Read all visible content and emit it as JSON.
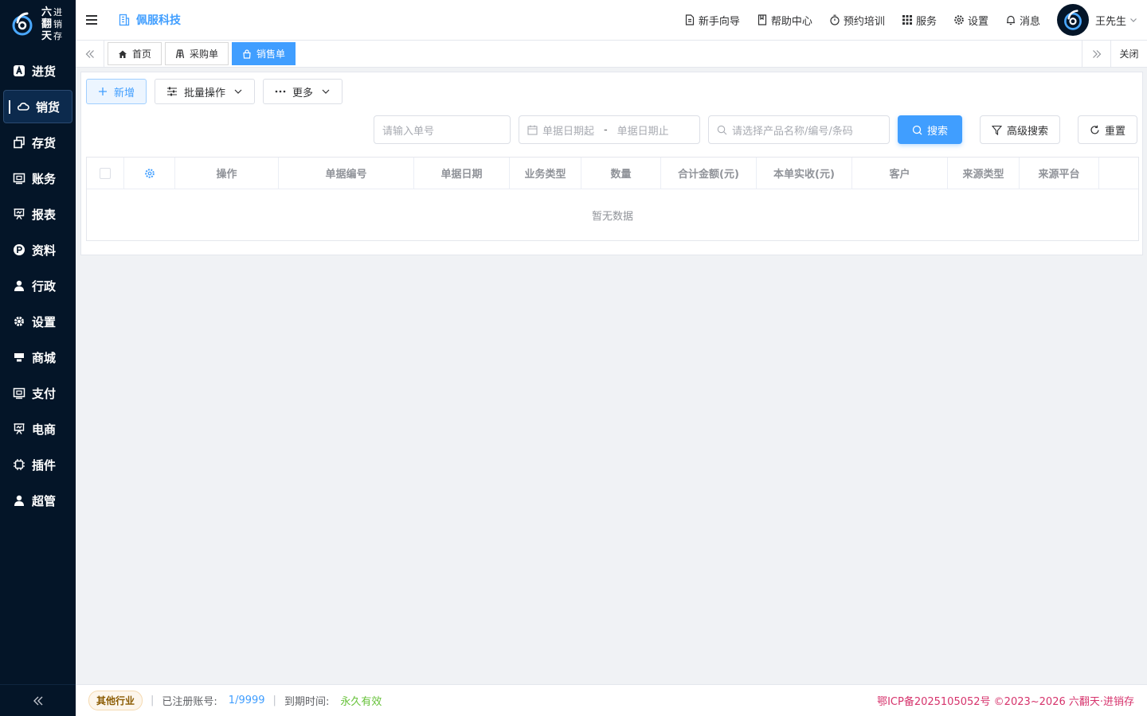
{
  "brand": {
    "name_big": [
      "六",
      "翻",
      "天"
    ],
    "name_small": [
      "进",
      "销",
      "存"
    ],
    "logo_icon": "six-spiral-logo"
  },
  "sidebar": {
    "items": [
      {
        "label": "进货",
        "icon": "a-box-icon",
        "active": false
      },
      {
        "label": "销货",
        "icon": "cloud-icon",
        "active": true
      },
      {
        "label": "存货",
        "icon": "copy-icon",
        "active": false
      },
      {
        "label": "账务",
        "icon": "wallet-icon",
        "active": false
      },
      {
        "label": "报表",
        "icon": "presentation-icon",
        "active": false
      },
      {
        "label": "资料",
        "icon": "p-circle-icon",
        "active": false
      },
      {
        "label": "行政",
        "icon": "user-icon",
        "active": false
      },
      {
        "label": "设置",
        "icon": "gear-icon",
        "active": false
      },
      {
        "label": "商城",
        "icon": "store-icon",
        "active": false
      },
      {
        "label": "支付",
        "icon": "wallet-icon",
        "active": false
      },
      {
        "label": "电商",
        "icon": "presentation-icon",
        "active": false
      },
      {
        "label": "插件",
        "icon": "chip-icon",
        "active": false
      },
      {
        "label": "超管",
        "icon": "user-icon",
        "active": false
      }
    ],
    "collapse_icon": "double-chevron-left-icon"
  },
  "header": {
    "company": "佩服科技",
    "links": [
      {
        "label": "新手向导",
        "icon": "document-icon"
      },
      {
        "label": "帮助中心",
        "icon": "book-icon"
      },
      {
        "label": "预约培训",
        "icon": "stopwatch-icon"
      },
      {
        "label": "服务",
        "icon": "grid-icon"
      },
      {
        "label": "设置",
        "icon": "gear-icon"
      },
      {
        "label": "消息",
        "icon": "bell-icon"
      }
    ],
    "user_name": "王先生"
  },
  "tabs": {
    "items": [
      {
        "label": "首页",
        "icon": "home-icon",
        "active": false
      },
      {
        "label": "采购单",
        "icon": "truck-icon",
        "active": false
      },
      {
        "label": "销售单",
        "icon": "bag-icon",
        "active": true
      }
    ],
    "close_label": "关闭"
  },
  "toolbar": {
    "add_label": "新增",
    "batch_label": "批量操作",
    "more_label": "更多"
  },
  "search": {
    "order_placeholder": "请输入单号",
    "date_start_placeholder": "单据日期起",
    "date_sep": "-",
    "date_end_placeholder": "单据日期止",
    "product_placeholder": "请选择产品名称/编号/条码",
    "search_label": "搜索",
    "advanced_label": "高级搜索",
    "reset_label": "重置"
  },
  "table": {
    "columns": [
      "操作",
      "单据编号",
      "单据日期",
      "业务类型",
      "数量",
      "合计金额(元)",
      "本单实收(元)",
      "客户",
      "来源类型",
      "来源平台"
    ],
    "empty_text": "暂无数据"
  },
  "footer": {
    "industry": "其他行业",
    "registered_label": "已注册账号:",
    "registered_value": "1/9999",
    "expiry_label": "到期时间:",
    "expiry_value": "永久有效",
    "icp": "鄂ICP备2025105052号 ©2023~2026 六翻天·进销存"
  },
  "colors": {
    "sidebar_bg": "#041528",
    "primary": "#409eff",
    "success": "#67c23a",
    "icp": "#d6336c"
  }
}
